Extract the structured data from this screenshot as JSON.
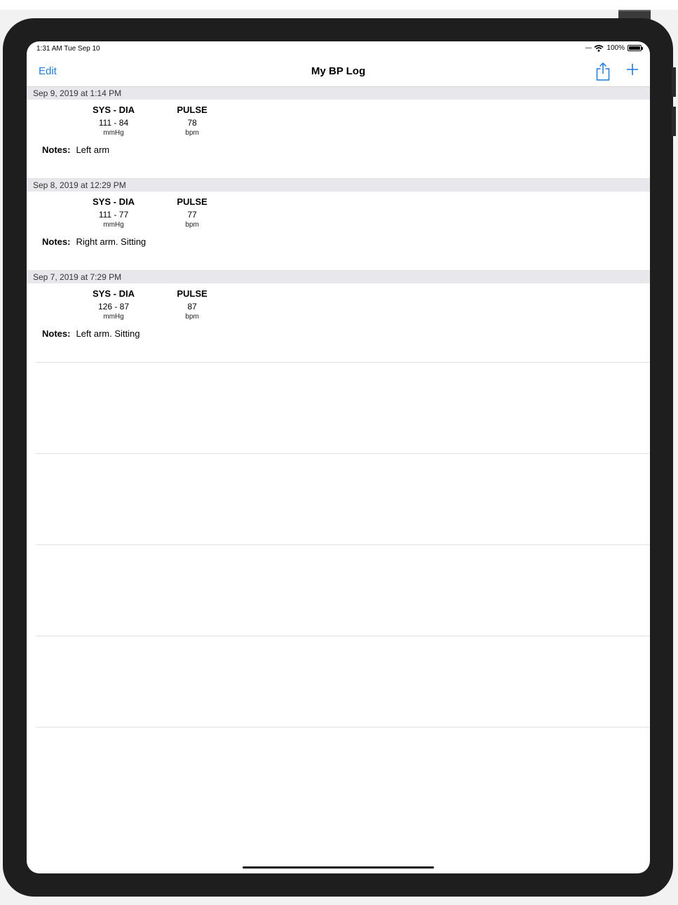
{
  "status_bar": {
    "time": "1:31 AM  Tue Sep 10",
    "battery": "100%"
  },
  "nav": {
    "edit_label": "Edit",
    "title": "My BP Log"
  },
  "columns": {
    "bp_title": "SYS - DIA",
    "bp_unit": "mmHg",
    "pulse_title": "PULSE",
    "pulse_unit": "bpm",
    "notes_label": "Notes:"
  },
  "entries": [
    {
      "date": "Sep 9, 2019 at 1:14 PM",
      "bp": "111 - 84",
      "pulse": "78",
      "notes": "Left arm"
    },
    {
      "date": "Sep 8, 2019 at 12:29 PM",
      "bp": "111 - 77",
      "pulse": "77",
      "notes": "Right arm.  Sitting"
    },
    {
      "date": "Sep 7, 2019 at 7:29 PM",
      "bp": "126 - 87",
      "pulse": "87",
      "notes": "Left arm.  Sitting"
    }
  ],
  "colors": {
    "accent": "#1f7bd6",
    "section_header_bg": "#e8e8ec",
    "device_frame": "#1e1e1e"
  }
}
